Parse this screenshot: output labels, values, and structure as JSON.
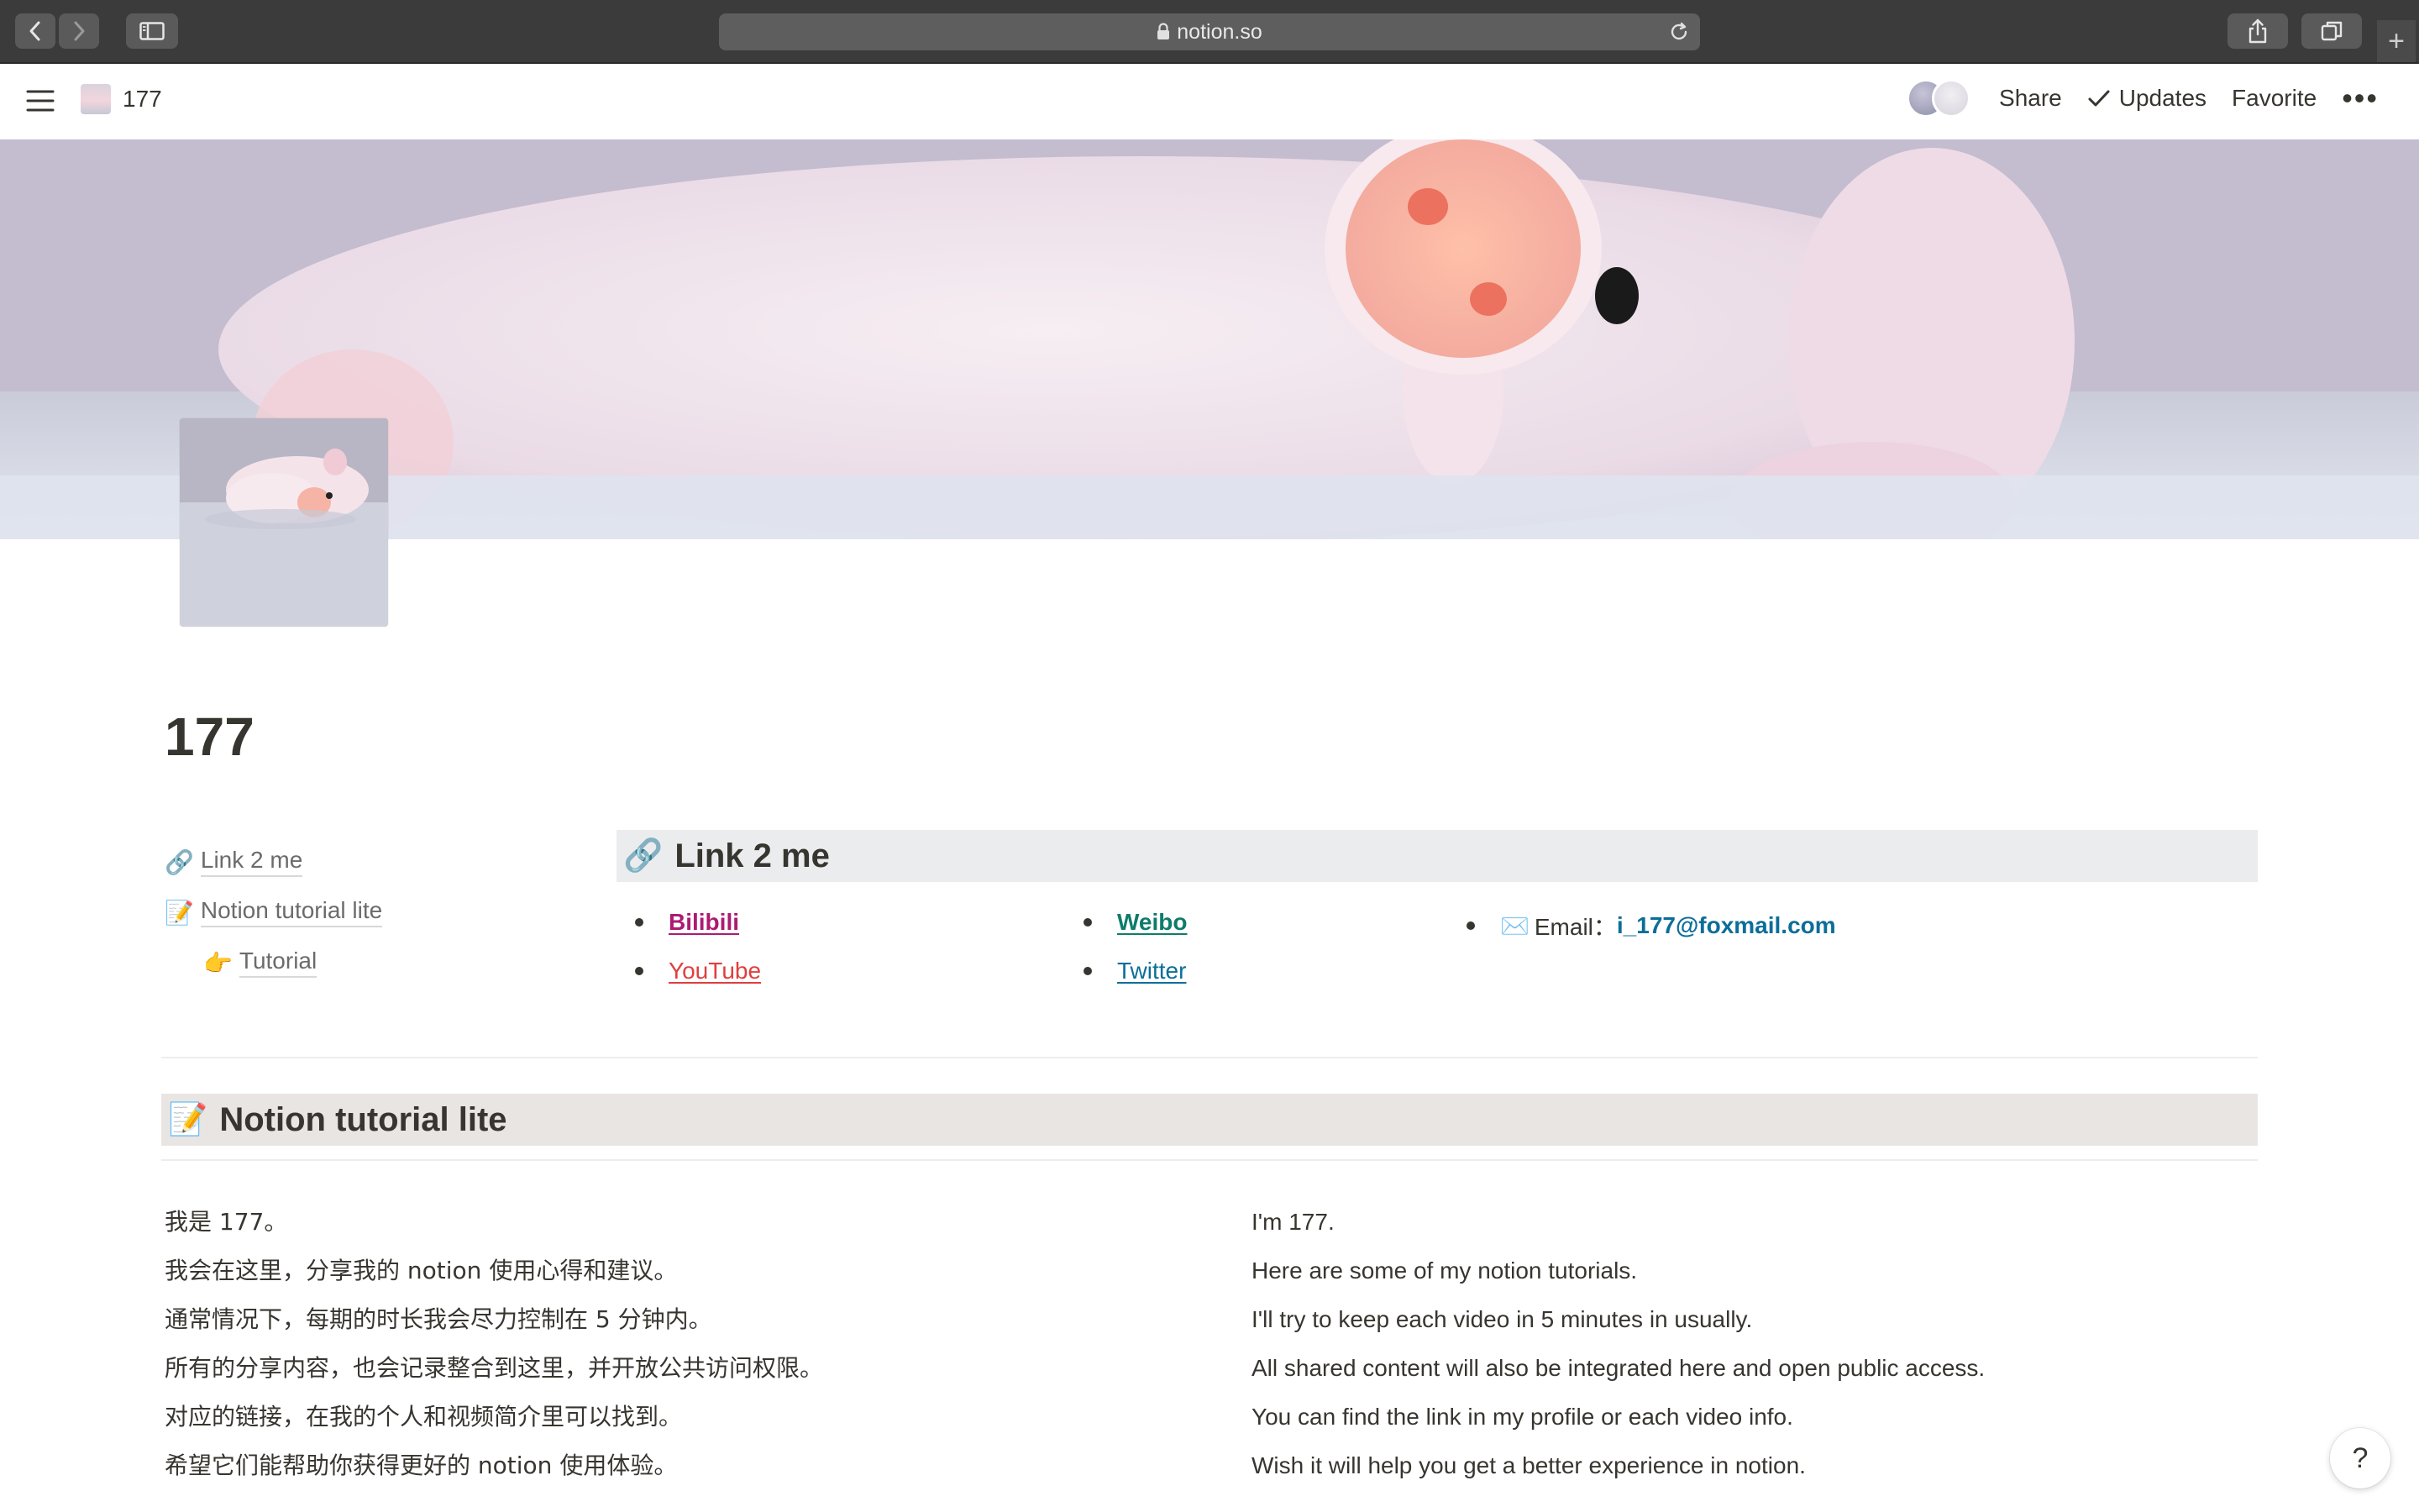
{
  "browser": {
    "url": "notion.so",
    "new_tab_symbol": "+"
  },
  "topbar": {
    "page_name": "177",
    "share_label": "Share",
    "updates_label": "Updates",
    "favorite_label": "Favorite",
    "more_label": "•••"
  },
  "page": {
    "title": "177"
  },
  "toc": {
    "items": [
      {
        "emoji": "🔗",
        "label": "Link 2 me"
      },
      {
        "emoji": "📝",
        "label": "Notion tutorial lite"
      },
      {
        "emoji": "👉",
        "label": "Tutorial"
      }
    ]
  },
  "links_section": {
    "emoji": "🔗",
    "heading": "Link 2 me",
    "links": {
      "bilibili": "Bilibili",
      "youtube": "YouTube",
      "weibo": "Weibo",
      "twitter": "Twitter",
      "email_emoji": "✉️",
      "email_label": "Email：",
      "email_value": "i_177@foxmail.com"
    }
  },
  "tutorial_section": {
    "emoji": "📝",
    "heading": "Notion tutorial lite",
    "zh_lines": [
      "我是 177。",
      "我会在这里，分享我的 notion 使用心得和建议。",
      "通常情况下，每期的时长我会尽力控制在 5 分钟内。",
      "所有的分享内容，也会记录整合到这里，并开放公共访问权限。",
      "对应的链接，在我的个人和视频简介里可以找到。",
      "希望它们能帮助你获得更好的 notion 使用体验。"
    ],
    "en_lines": [
      "I'm 177.",
      "Here are some of my notion tutorials.",
      "I'll try to keep each video in 5 minutes in usually.",
      "All shared content will also be integrated here and open public access.",
      "You can find the link in my profile or each video info.",
      "Wish it will help you get a better experience in notion."
    ]
  },
  "help": {
    "label": "?"
  }
}
